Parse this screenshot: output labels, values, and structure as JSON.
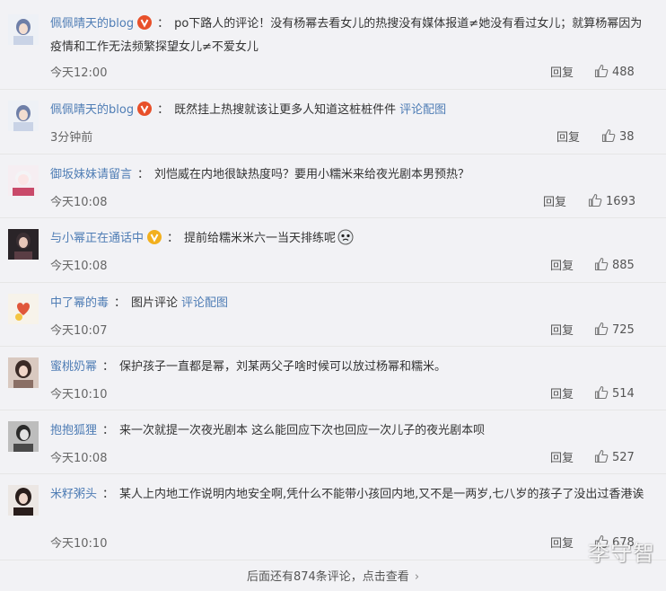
{
  "comments": [
    {
      "name": "佩佩晴天的blog",
      "badge": "red",
      "text": "po下路人的评论！没有杨幂去看女儿的热搜没有媒体报道≠她没有看过女儿；就算杨幂因为疫情和工作无法频繁探望女儿≠不爱女儿",
      "pic_link": "",
      "time": "今天12:00",
      "reply": "回复",
      "likes": "488"
    },
    {
      "name": "佩佩晴天的blog",
      "badge": "red",
      "text": "既然挂上热搜就该让更多人知道这桩桩件件",
      "pic_link": "评论配图",
      "time": "3分钟前",
      "reply": "回复",
      "likes": "38"
    },
    {
      "name": "御坂妹妹请留言",
      "badge": "",
      "text": "刘恺威在内地很缺热度吗？要用小糯米来给夜光剧本男预热？",
      "pic_link": "",
      "time": "今天10:08",
      "reply": "回复",
      "likes": "1693"
    },
    {
      "name": "与小幂正在通话中",
      "badge": "gold",
      "text": "提前给糯米米六一当天排练呢",
      "pic_link": "",
      "time": "今天10:08",
      "reply": "回复",
      "likes": "885"
    },
    {
      "name": "中了幂的毒",
      "badge": "",
      "text": "图片评论",
      "pic_link": "评论配图",
      "time": "今天10:07",
      "reply": "回复",
      "likes": "725"
    },
    {
      "name": "蜜桃奶幂",
      "badge": "",
      "text": "保护孩子一直都是幂，刘某两父子啥时候可以放过杨幂和糯米。",
      "pic_link": "",
      "time": "今天10:10",
      "reply": "回复",
      "likes": "514"
    },
    {
      "name": "抱抱狐狸",
      "badge": "",
      "text": "来一次就提一次夜光剧本 这么能回应下次也回应一次儿子的夜光剧本呗",
      "pic_link": "",
      "time": "今天10:08",
      "reply": "回复",
      "likes": "527"
    },
    {
      "name": "米籽粥头",
      "badge": "",
      "text": "某人上内地工作说明内地安全啊,凭什么不能带小孩回内地,又不是一两岁,七八岁的孩子了没出过香港诶",
      "pic_link": "",
      "time": "今天10:10",
      "reply": "回复",
      "likes": "678"
    }
  ],
  "more_text": "后面还有874条评论，点击查看",
  "watermark": "李守智",
  "colors": {
    "link": "#4f7db5",
    "background": "#f2f2f5",
    "badge_red": "#e8502a",
    "badge_gold": "#f2b01e"
  },
  "icons": {
    "like": "thumbs-up-icon",
    "verified": "verified-v-icon",
    "chevron": "chevron-right-icon"
  }
}
